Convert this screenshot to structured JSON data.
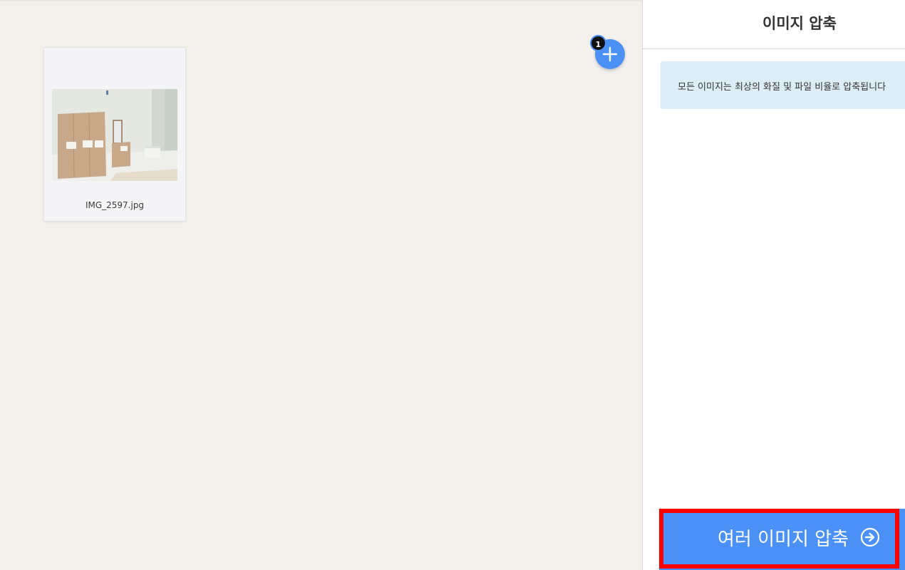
{
  "workspace": {
    "files": [
      {
        "name": "IMG_2597.jpg",
        "thumbnail": "room-photo"
      }
    ],
    "add_button": {
      "icon": "plus-icon"
    },
    "file_count": "1"
  },
  "sidebar": {
    "title": "이미지 압축",
    "info": "모든 이미지는 최상의 화질 및 파일 비율로 압축됩니다",
    "compress_button": {
      "label": "여러 이미지 압축",
      "icon": "arrow-right-circle-icon"
    }
  },
  "colors": {
    "accent": "#4a90f7",
    "workspace_bg": "#f3f0ec",
    "info_bg": "#dcedf8",
    "highlight": "#ff0000"
  }
}
